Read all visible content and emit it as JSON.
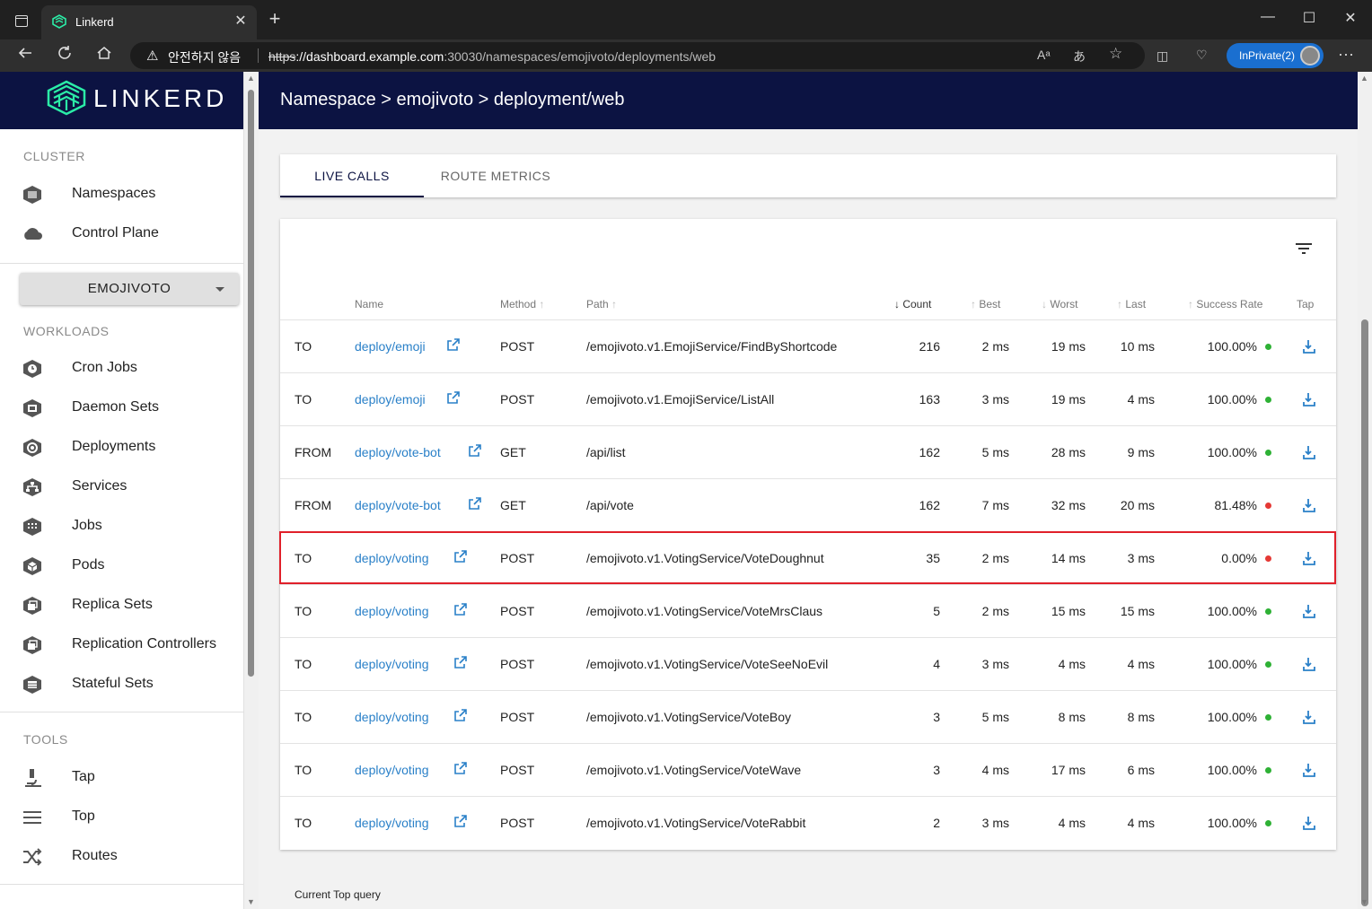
{
  "browser": {
    "tab_title": "Linkerd",
    "tab_close": "✕",
    "new_tab": "+",
    "window_controls": {
      "minimize": "—",
      "maximize": "☐",
      "close": "✕"
    },
    "security_warning": "안전하지 않음",
    "url_protocol": "https",
    "url_host": "://dashboard.example.com",
    "url_rest": ":30030/namespaces/emojivoto/deployments/web",
    "inprivate_label": "InPrivate(2)",
    "more": "···"
  },
  "sidebar": {
    "logo_text": "LINKERD",
    "cluster_label": "CLUSTER",
    "cluster_items": [
      {
        "label": "Namespaces",
        "icon": "namespace-icon"
      },
      {
        "label": "Control Plane",
        "icon": "cloud-icon"
      }
    ],
    "namespace_selector": "EMOJIVOTO",
    "workloads_label": "WORKLOADS",
    "workload_items": [
      {
        "label": "Cron Jobs",
        "icon": "cronjob-icon"
      },
      {
        "label": "Daemon Sets",
        "icon": "daemonset-icon"
      },
      {
        "label": "Deployments",
        "icon": "deployment-icon"
      },
      {
        "label": "Services",
        "icon": "service-icon"
      },
      {
        "label": "Jobs",
        "icon": "job-icon"
      },
      {
        "label": "Pods",
        "icon": "pod-icon"
      },
      {
        "label": "Replica Sets",
        "icon": "replicaset-icon"
      },
      {
        "label": "Replication Controllers",
        "icon": "replicationcontroller-icon"
      },
      {
        "label": "Stateful Sets",
        "icon": "statefulset-icon"
      }
    ],
    "tools_label": "TOOLS",
    "tool_items": [
      {
        "label": "Tap",
        "icon": "microscope-icon"
      },
      {
        "label": "Top",
        "icon": "list-icon"
      },
      {
        "label": "Routes",
        "icon": "shuffle-icon"
      }
    ]
  },
  "main": {
    "breadcrumb": "Namespace > emojivoto > deployment/web",
    "tabs": [
      {
        "label": "LIVE CALLS",
        "active": true
      },
      {
        "label": "ROUTE METRICS",
        "active": false
      }
    ],
    "columns": {
      "name": "Name",
      "method": "Method",
      "path": "Path",
      "count": "Count",
      "best": "Best",
      "worst": "Worst",
      "last": "Last",
      "success_rate": "Success Rate",
      "tap": "Tap"
    },
    "rows": [
      {
        "direction": "TO",
        "name": "deploy/emoji",
        "method": "POST",
        "path": "/emojivoto.v1.EmojiService/FindByShortcode",
        "count": "216",
        "best": "2 ms",
        "worst": "19 ms",
        "last": "10 ms",
        "success_rate": "100.00%",
        "status": "good"
      },
      {
        "direction": "TO",
        "name": "deploy/emoji",
        "method": "POST",
        "path": "/emojivoto.v1.EmojiService/ListAll",
        "count": "163",
        "best": "3 ms",
        "worst": "19 ms",
        "last": "4 ms",
        "success_rate": "100.00%",
        "status": "good"
      },
      {
        "direction": "FROM",
        "name": "deploy/vote-bot",
        "method": "GET",
        "path": "/api/list",
        "count": "162",
        "best": "5 ms",
        "worst": "28 ms",
        "last": "9 ms",
        "success_rate": "100.00%",
        "status": "good"
      },
      {
        "direction": "FROM",
        "name": "deploy/vote-bot",
        "method": "GET",
        "path": "/api/vote",
        "count": "162",
        "best": "7 ms",
        "worst": "32 ms",
        "last": "20 ms",
        "success_rate": "81.48%",
        "status": "bad"
      },
      {
        "direction": "TO",
        "name": "deploy/voting",
        "method": "POST",
        "path": "/emojivoto.v1.VotingService/VoteDoughnut",
        "count": "35",
        "best": "2 ms",
        "worst": "14 ms",
        "last": "3 ms",
        "success_rate": "0.00%",
        "status": "bad",
        "highlighted": true
      },
      {
        "direction": "TO",
        "name": "deploy/voting",
        "method": "POST",
        "path": "/emojivoto.v1.VotingService/VoteMrsClaus",
        "count": "5",
        "best": "2 ms",
        "worst": "15 ms",
        "last": "15 ms",
        "success_rate": "100.00%",
        "status": "good"
      },
      {
        "direction": "TO",
        "name": "deploy/voting",
        "method": "POST",
        "path": "/emojivoto.v1.VotingService/VoteSeeNoEvil",
        "count": "4",
        "best": "3 ms",
        "worst": "4 ms",
        "last": "4 ms",
        "success_rate": "100.00%",
        "status": "good"
      },
      {
        "direction": "TO",
        "name": "deploy/voting",
        "method": "POST",
        "path": "/emojivoto.v1.VotingService/VoteBoy",
        "count": "3",
        "best": "5 ms",
        "worst": "8 ms",
        "last": "8 ms",
        "success_rate": "100.00%",
        "status": "good"
      },
      {
        "direction": "TO",
        "name": "deploy/voting",
        "method": "POST",
        "path": "/emojivoto.v1.VotingService/VoteWave",
        "count": "3",
        "best": "4 ms",
        "worst": "17 ms",
        "last": "6 ms",
        "success_rate": "100.00%",
        "status": "good"
      },
      {
        "direction": "TO",
        "name": "deploy/voting",
        "method": "POST",
        "path": "/emojivoto.v1.VotingService/VoteRabbit",
        "count": "2",
        "best": "3 ms",
        "worst": "4 ms",
        "last": "4 ms",
        "success_rate": "100.00%",
        "status": "good"
      }
    ],
    "bottom_label": "Current Top query"
  },
  "colors": {
    "navy": "#0c1342",
    "link": "#2a80c8",
    "good": "#2eb135",
    "bad": "#e53935",
    "highlight_border": "#e0202a"
  }
}
